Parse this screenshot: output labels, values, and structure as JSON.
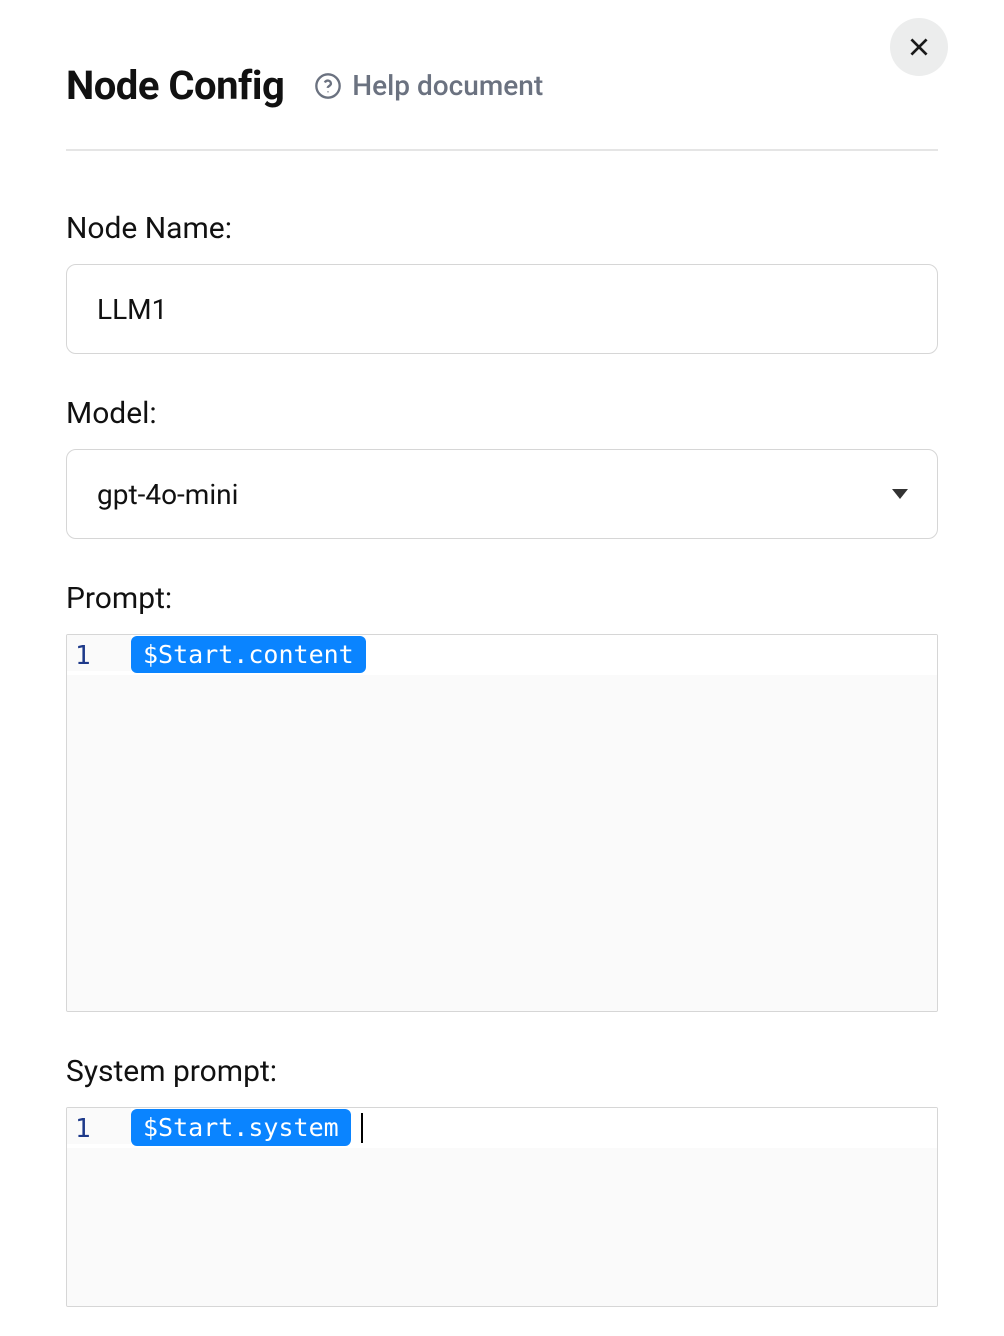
{
  "header": {
    "title": "Node Config",
    "help_label": "Help document"
  },
  "fields": {
    "node_name": {
      "label": "Node Name:",
      "value": "LLM1"
    },
    "model": {
      "label": "Model:",
      "value": "gpt-4o-mini"
    },
    "prompt": {
      "label": "Prompt:",
      "line_number": "1",
      "variable": "$Start.content"
    },
    "system_prompt": {
      "label": "System prompt:",
      "line_number": "1",
      "variable": "$Start.system"
    }
  }
}
